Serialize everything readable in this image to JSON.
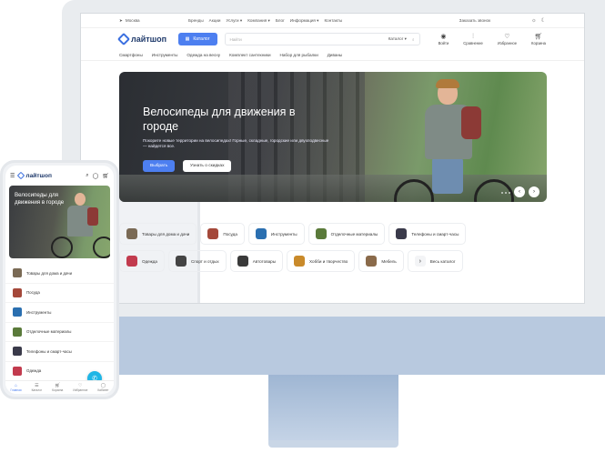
{
  "desktop": {
    "topbar": {
      "location": "Москва",
      "menu": [
        "Бренды",
        "Акции",
        "Услуги ▾",
        "Компания ▾",
        "Блог",
        "Информация ▾",
        "Контакты"
      ],
      "phone": "+7 100 000-00-00 ▾",
      "callback": "Заказать звонок"
    },
    "header": {
      "logo": "лайтшоп",
      "catalog_button": "Каталог",
      "search_placeholder": "Найти",
      "search_scope": "Каталог ▾",
      "icons": [
        {
          "icon": "login-icon",
          "label": "Войти"
        },
        {
          "icon": "compare-icon",
          "label": "Сравнение"
        },
        {
          "icon": "heart-icon",
          "label": "Избранное"
        },
        {
          "icon": "cart-icon",
          "label": "Корзина"
        }
      ]
    },
    "subnav": [
      "Смартфоны",
      "Инструменты",
      "Одежда на весну",
      "Комплект сантехники",
      "Набор для рыбалки",
      "Диваны"
    ],
    "hero": {
      "title": "Велосипеды для движения в городе",
      "text": "Покорите новые территории на велосипедах! Горные, складные, городские или двухподвесные — найдется все.",
      "primary_button": "Выбрать",
      "secondary_button": "Узнать о скидках"
    },
    "categories_row1": [
      {
        "label": "Товары для дома и дачи",
        "color": "#7a6a55"
      },
      {
        "label": "Посуда",
        "color": "#a4483a"
      },
      {
        "label": "Инструменты",
        "color": "#2a6fb0"
      },
      {
        "label": "Отделочные материалы",
        "color": "#5a7a3a"
      },
      {
        "label": "Телефоны и смарт-часы",
        "color": "#3a3a4a"
      }
    ],
    "categories_row2": [
      {
        "label": "Одежда",
        "color": "#c23b4e"
      },
      {
        "label": "Спорт и отдых",
        "color": "#444444"
      },
      {
        "label": "Автотовары",
        "color": "#3a3a3a"
      },
      {
        "label": "Хобби и творчество",
        "color": "#c98a2a"
      },
      {
        "label": "Мебель",
        "color": "#8a6a4a"
      },
      {
        "label": "Весь каталог",
        "color": "#ffffff"
      }
    ]
  },
  "mobile": {
    "logo": "лайтшоп",
    "hero_title": "Велосипеды для движения в городе",
    "list": [
      {
        "label": "Товары для дома и дачи",
        "color": "#7a6a55"
      },
      {
        "label": "Посуда",
        "color": "#a4483a"
      },
      {
        "label": "Инструменты",
        "color": "#2a6fb0"
      },
      {
        "label": "Отделочные материалы",
        "color": "#5a7a3a"
      },
      {
        "label": "Телефоны и смарт-часы",
        "color": "#3a3a4a"
      },
      {
        "label": "Одежда",
        "color": "#c23b4e"
      }
    ],
    "tabbar": [
      {
        "icon": "home-icon",
        "label": "Главная"
      },
      {
        "icon": "catalog-icon",
        "label": "Каталог"
      },
      {
        "icon": "cart-icon",
        "label": "Корзина"
      },
      {
        "icon": "heart-icon",
        "label": "Избранное"
      },
      {
        "icon": "user-icon",
        "label": "Кабинет"
      }
    ]
  }
}
